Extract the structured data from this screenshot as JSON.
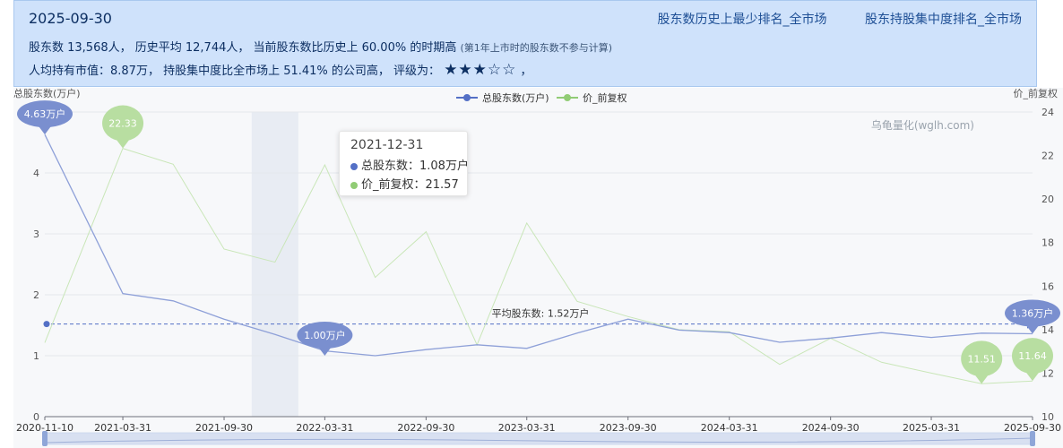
{
  "summary": {
    "date": "2025-09-30",
    "link_min_rank": "股东数历史上最少排名_全市场",
    "link_concentration_rank": "股东持股集中度排名_全市场",
    "line2_main": "股东数 13,568人，  历史平均 12,744人，  当前股东数比历史上 60.00% 的时期高",
    "line2_note": "(第1年上市时的股东数不参与计算)",
    "line3_main": "人均持有市值：8.87万，  持股集中度比全市场上 51.41% 的公司高，  评级为：",
    "rating_stars": "★★★☆☆",
    "rating_suffix": "，",
    "rating_value": 3
  },
  "tooltip": {
    "date": "2021-12-31",
    "row1": "总股东数：1.08万户",
    "row2": "价_前复权：21.57"
  },
  "watermark": "乌龟量化(wglh.com)",
  "colors": {
    "holders": "#5470c6",
    "price": "#91cc75",
    "accent_bg": "#cfe2fb"
  },
  "chart_data": {
    "type": "line",
    "y_left_label": "总股东数(万户)",
    "y_right_label": "价_前复权",
    "y_left_range": [
      0,
      5
    ],
    "y_left_ticks": [
      "0",
      "1",
      "2",
      "3",
      "4",
      "5"
    ],
    "y_right_range": [
      10,
      24
    ],
    "y_right_ticks": [
      "10",
      "12",
      "14",
      "16",
      "18",
      "20",
      "22",
      "24"
    ],
    "x_tick_labels": [
      "2020-11-10",
      "2021-03-31",
      "2021-09-30",
      "2022-03-31",
      "2022-09-30",
      "2023-03-31",
      "2023-09-30",
      "2024-03-31",
      "2024-09-30",
      "2025-03-31",
      "2025-09-30"
    ],
    "x": [
      "2020-11-10",
      "2021-03-31",
      "2021-06-30",
      "2021-09-30",
      "2021-12-31",
      "2022-03-31",
      "2022-06-30",
      "2022-09-30",
      "2022-12-31",
      "2023-03-31",
      "2023-06-30",
      "2023-09-30",
      "2023-12-31",
      "2024-03-31",
      "2024-06-30",
      "2024-09-30",
      "2024-12-31",
      "2025-03-31",
      "2025-06-30",
      "2025-09-30"
    ],
    "series": [
      {
        "name": "总股东数(万户)",
        "axis": "left",
        "values": [
          4.63,
          2.02,
          1.9,
          1.6,
          1.35,
          1.08,
          1.0,
          1.1,
          1.18,
          1.12,
          1.37,
          1.6,
          1.42,
          1.38,
          1.22,
          1.29,
          1.38,
          1.3,
          1.37,
          1.36
        ]
      },
      {
        "name": "价_前复权",
        "axis": "right",
        "values": [
          13.4,
          22.33,
          21.6,
          17.7,
          17.1,
          21.57,
          16.4,
          18.5,
          13.3,
          18.9,
          15.3,
          14.6,
          14.0,
          13.9,
          12.4,
          13.6,
          12.5,
          12.0,
          11.51,
          11.64
        ]
      }
    ],
    "markers": [
      {
        "label": "4.63万户",
        "series": "总股东数(万户)",
        "x": "2020-11-10",
        "value": 4.63
      },
      {
        "label": "1.00万户",
        "series": "总股东数(万户)",
        "x": "2022-03-31",
        "value": 1.0
      },
      {
        "label": "1.36万户",
        "series": "总股东数(万户)",
        "x": "2025-09-30",
        "value": 1.36
      },
      {
        "label": "22.33",
        "series": "价_前复权",
        "x": "2021-03-31",
        "value": 22.33
      },
      {
        "label": "11.51",
        "series": "价_前复权",
        "x": "2025-06-30",
        "value": 11.51
      },
      {
        "label": "11.64",
        "series": "价_前复权",
        "x": "2025-09-30",
        "value": 11.64
      }
    ],
    "average_line": {
      "label": "平均股东数: 1.52万户",
      "value": 1.52
    },
    "highlight_x": "2021-12-31",
    "legend_position": "top-center",
    "grid": true
  }
}
